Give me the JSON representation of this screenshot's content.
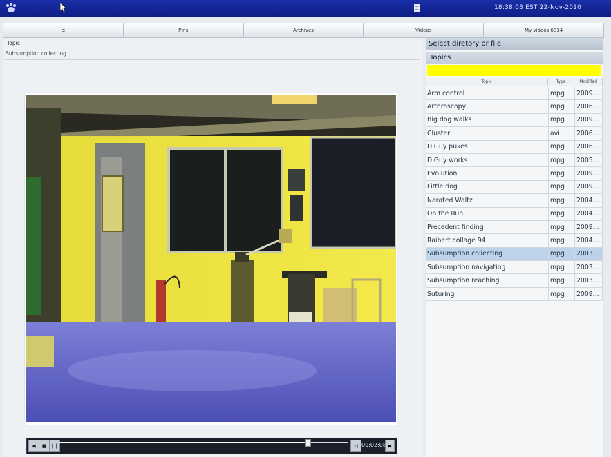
{
  "header": {
    "time": "18:38:03 EST 22-Nov-2010"
  },
  "tabs": [
    "⊏",
    "Pins",
    "Archives",
    "Videos",
    "My videos 6834"
  ],
  "topic": {
    "label": "Topic",
    "value": "Subsumption collecting"
  },
  "player": {
    "time": "00:02:08",
    "progress": 0.86
  },
  "panel": {
    "title": "Select diretory or file",
    "subtitle": "Topics",
    "columns": [
      "Topic",
      "Type",
      "Modified"
    ],
    "rows": [
      {
        "topic": "Arm control",
        "type": "mpg",
        "modified": "2009..."
      },
      {
        "topic": "Arthroscopy",
        "type": "mpg",
        "modified": "2006..."
      },
      {
        "topic": "Big dog walks",
        "type": "mpg",
        "modified": "2009..."
      },
      {
        "topic": "Cluster",
        "type": "avi",
        "modified": "2006..."
      },
      {
        "topic": "DiGuy pukes",
        "type": "mpg",
        "modified": "2006..."
      },
      {
        "topic": "DiGuy works",
        "type": "mpg",
        "modified": "2005..."
      },
      {
        "topic": "Evolution",
        "type": "mpg",
        "modified": "2009..."
      },
      {
        "topic": "Little dog",
        "type": "mpg",
        "modified": "2009..."
      },
      {
        "topic": "Narated Waltz",
        "type": "mpg",
        "modified": "2004..."
      },
      {
        "topic": "On the Run",
        "type": "mpg",
        "modified": "2004..."
      },
      {
        "topic": "Precedent finding",
        "type": "mpg",
        "modified": "2009..."
      },
      {
        "topic": "Raibert collage 94",
        "type": "mpg",
        "modified": "2004..."
      },
      {
        "topic": "Subsumption collecting",
        "type": "mpg",
        "modified": "2003..."
      },
      {
        "topic": "Subsumption navigating",
        "type": "mpg",
        "modified": "2003..."
      },
      {
        "topic": "Subsumption reaching",
        "type": "mpg",
        "modified": "2003..."
      },
      {
        "topic": "Suturing",
        "type": "mpg",
        "modified": "2009..."
      }
    ],
    "selected": 12
  },
  "icons": {
    "logo": "paw-logo-icon",
    "cursor": "mouse-cursor-icon",
    "doc": "document-icon"
  }
}
